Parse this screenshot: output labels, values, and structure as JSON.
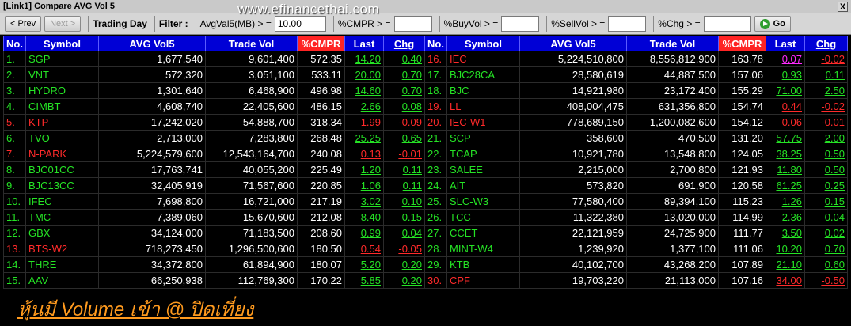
{
  "window": {
    "title": "[Link1] Compare AVG Vol 5",
    "close_label": "X"
  },
  "watermark": "www.efinancethai.com",
  "toolbar": {
    "prev_label": "< Prev",
    "next_label": "Next >",
    "trading_day": "Trading Day",
    "filter_label": "Filter :",
    "avgvol_label": "AvgVal5(MB) > =",
    "avgvol_value": "10.00",
    "cmpr_label": "%CMPR > =",
    "cmpr_value": "",
    "buyvol_label": "%BuyVol > =",
    "buyvol_value": "",
    "sellvol_label": "%SellVol > =",
    "sellvol_value": "",
    "chg_label": "%Chg > =",
    "chg_value": "",
    "go_label": "Go"
  },
  "headers": {
    "no": "No.",
    "symbol": "Symbol",
    "avg": "AVG Vol5",
    "trade": "Trade Vol",
    "cmpr": "%CMPR",
    "last": "Last",
    "chg": "Chg"
  },
  "colors": {
    "up": "#25e325",
    "down": "#ff2a2a",
    "ceiling": "#ff2aff",
    "unchanged": "#ffff26",
    "header_bg": "#0000d6",
    "cmpr_bg": "#ff2424",
    "banner": "#ff9a1e"
  },
  "rows": [
    {
      "left": {
        "no": "1.",
        "symbol": "SGP",
        "avg": "1,677,540",
        "trade": "9,601,400",
        "cmpr": "572.35",
        "last": "14.20",
        "chg": "0.40",
        "dir": "g"
      },
      "right": {
        "no": "16.",
        "symbol": "IEC",
        "avg": "5,224,510,800",
        "trade": "8,556,812,900",
        "cmpr": "163.78",
        "last": "0.07",
        "chg": "-0.02",
        "dir": "r",
        "last_dir": "m"
      }
    },
    {
      "left": {
        "no": "2.",
        "symbol": "VNT",
        "avg": "572,320",
        "trade": "3,051,100",
        "cmpr": "533.11",
        "last": "20.00",
        "chg": "0.70",
        "dir": "g"
      },
      "right": {
        "no": "17.",
        "symbol": "BJC28CA",
        "avg": "28,580,619",
        "trade": "44,887,500",
        "cmpr": "157.06",
        "last": "0.93",
        "chg": "0.11",
        "dir": "g"
      }
    },
    {
      "left": {
        "no": "3.",
        "symbol": "HYDRO",
        "avg": "1,301,640",
        "trade": "6,468,900",
        "cmpr": "496.98",
        "last": "14.60",
        "chg": "0.70",
        "dir": "g"
      },
      "right": {
        "no": "18.",
        "symbol": "BJC",
        "avg": "14,921,980",
        "trade": "23,172,400",
        "cmpr": "155.29",
        "last": "71.00",
        "chg": "2.50",
        "dir": "g"
      }
    },
    {
      "left": {
        "no": "4.",
        "symbol": "CIMBT",
        "avg": "4,608,740",
        "trade": "22,405,600",
        "cmpr": "486.15",
        "last": "2.66",
        "chg": "0.08",
        "dir": "g"
      },
      "right": {
        "no": "19.",
        "symbol": "LL",
        "avg": "408,004,475",
        "trade": "631,356,800",
        "cmpr": "154.74",
        "last": "0.44",
        "chg": "-0.02",
        "dir": "r"
      }
    },
    {
      "left": {
        "no": "5.",
        "symbol": "KTP",
        "avg": "17,242,020",
        "trade": "54,888,700",
        "cmpr": "318.34",
        "last": "1.99",
        "chg": "-0.09",
        "dir": "r"
      },
      "right": {
        "no": "20.",
        "symbol": "IEC-W1",
        "avg": "778,689,150",
        "trade": "1,200,082,600",
        "cmpr": "154.12",
        "last": "0.06",
        "chg": "-0.01",
        "dir": "r"
      }
    },
    {
      "left": {
        "no": "6.",
        "symbol": "TVO",
        "avg": "2,713,000",
        "trade": "7,283,800",
        "cmpr": "268.48",
        "last": "25.25",
        "chg": "0.65",
        "dir": "g"
      },
      "right": {
        "no": "21.",
        "symbol": "SCP",
        "avg": "358,600",
        "trade": "470,500",
        "cmpr": "131.20",
        "last": "57.75",
        "chg": "2.00",
        "dir": "g"
      }
    },
    {
      "left": {
        "no": "7.",
        "symbol": "N-PARK",
        "avg": "5,224,579,600",
        "trade": "12,543,164,700",
        "cmpr": "240.08",
        "last": "0.13",
        "chg": "-0.01",
        "dir": "r"
      },
      "right": {
        "no": "22.",
        "symbol": "TCAP",
        "avg": "10,921,780",
        "trade": "13,548,800",
        "cmpr": "124.05",
        "last": "38.25",
        "chg": "0.50",
        "dir": "g"
      }
    },
    {
      "left": {
        "no": "8.",
        "symbol": "BJC01CC",
        "avg": "17,763,741",
        "trade": "40,055,200",
        "cmpr": "225.49",
        "last": "1.20",
        "chg": "0.11",
        "dir": "g"
      },
      "right": {
        "no": "23.",
        "symbol": "SALEE",
        "avg": "2,215,000",
        "trade": "2,700,800",
        "cmpr": "121.93",
        "last": "11.80",
        "chg": "0.50",
        "dir": "g"
      }
    },
    {
      "left": {
        "no": "9.",
        "symbol": "BJC13CC",
        "avg": "32,405,919",
        "trade": "71,567,600",
        "cmpr": "220.85",
        "last": "1.06",
        "chg": "0.11",
        "dir": "g"
      },
      "right": {
        "no": "24.",
        "symbol": "AIT",
        "avg": "573,820",
        "trade": "691,900",
        "cmpr": "120.58",
        "last": "61.25",
        "chg": "0.25",
        "dir": "g"
      }
    },
    {
      "left": {
        "no": "10.",
        "symbol": "IFEC",
        "avg": "7,698,800",
        "trade": "16,721,000",
        "cmpr": "217.19",
        "last": "3.02",
        "chg": "0.10",
        "dir": "g"
      },
      "right": {
        "no": "25.",
        "symbol": "SLC-W3",
        "avg": "77,580,400",
        "trade": "89,394,100",
        "cmpr": "115.23",
        "last": "1.26",
        "chg": "0.15",
        "dir": "g"
      }
    },
    {
      "left": {
        "no": "11.",
        "symbol": "TMC",
        "avg": "7,389,060",
        "trade": "15,670,600",
        "cmpr": "212.08",
        "last": "8.40",
        "chg": "0.15",
        "dir": "g"
      },
      "right": {
        "no": "26.",
        "symbol": "TCC",
        "avg": "11,322,380",
        "trade": "13,020,000",
        "cmpr": "114.99",
        "last": "2.36",
        "chg": "0.04",
        "dir": "g"
      }
    },
    {
      "left": {
        "no": "12.",
        "symbol": "GBX",
        "avg": "34,124,000",
        "trade": "71,183,500",
        "cmpr": "208.60",
        "last": "0.99",
        "chg": "0.04",
        "dir": "g"
      },
      "right": {
        "no": "27.",
        "symbol": "CCET",
        "avg": "22,121,959",
        "trade": "24,725,900",
        "cmpr": "111.77",
        "last": "3.50",
        "chg": "0.02",
        "dir": "g"
      }
    },
    {
      "left": {
        "no": "13.",
        "symbol": "BTS-W2",
        "avg": "718,273,450",
        "trade": "1,296,500,600",
        "cmpr": "180.50",
        "last": "0.54",
        "chg": "-0.05",
        "dir": "r"
      },
      "right": {
        "no": "28.",
        "symbol": "MINT-W4",
        "avg": "1,239,920",
        "trade": "1,377,100",
        "cmpr": "111.06",
        "last": "10.20",
        "chg": "0.70",
        "dir": "g"
      }
    },
    {
      "left": {
        "no": "14.",
        "symbol": "THRE",
        "avg": "34,372,800",
        "trade": "61,894,900",
        "cmpr": "180.07",
        "last": "5.20",
        "chg": "0.20",
        "dir": "g"
      },
      "right": {
        "no": "29.",
        "symbol": "KTB",
        "avg": "40,102,700",
        "trade": "43,268,200",
        "cmpr": "107.89",
        "last": "21.10",
        "chg": "0.60",
        "dir": "g"
      }
    },
    {
      "left": {
        "no": "15.",
        "symbol": "AAV",
        "avg": "66,250,938",
        "trade": "112,769,300",
        "cmpr": "170.22",
        "last": "5.85",
        "chg": "0.20",
        "dir": "g"
      },
      "right": {
        "no": "30.",
        "symbol": "CPF",
        "avg": "19,703,220",
        "trade": "21,113,000",
        "cmpr": "107.16",
        "last": "34.00",
        "chg": "-0.50",
        "dir": "r"
      }
    }
  ],
  "footer": {
    "banner": "หุ้นมี Volume เข้า @ ปิดเที่ยง"
  }
}
